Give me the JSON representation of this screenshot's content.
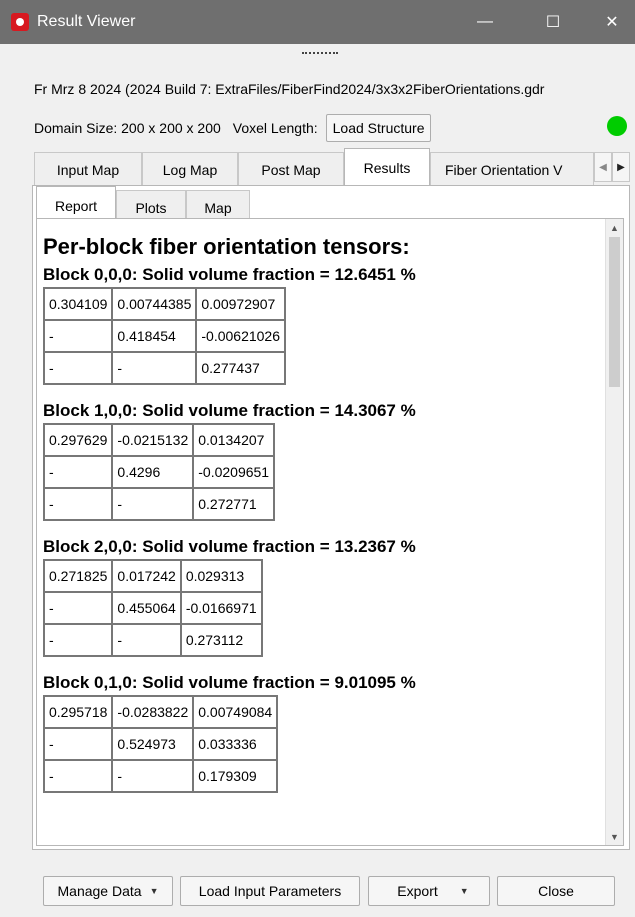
{
  "window": {
    "title": "Result Viewer",
    "minimize": "—",
    "maximize": "☐",
    "close": "✕"
  },
  "info": {
    "version_line": "Fr Mrz 8 2024 (2024 Build 7: ExtraFiles/FiberFind2024/3x3x2FiberOrientations.gdr",
    "domain_size": "Domain Size: 200 x 200 x 200",
    "voxel_length": "Voxel Length:",
    "load_structure": "Load Structure",
    "status_color": "#00cc00"
  },
  "outer_tabs": [
    "Input Map",
    "Log Map",
    "Post Map",
    "Results",
    "Fiber Orientation V"
  ],
  "inner_tabs": [
    "Report",
    "Plots",
    "Map"
  ],
  "report": {
    "heading": "Per-block fiber orientation tensors:",
    "blocks": [
      {
        "title": "Block 0,0,0: Solid volume fraction = 12.6451 %",
        "rows": [
          [
            "0.304109",
            "0.00744385",
            "0.00972907"
          ],
          [
            "-",
            "0.418454",
            "-0.00621026"
          ],
          [
            "-",
            "-",
            "0.277437"
          ]
        ]
      },
      {
        "title": "Block 1,0,0: Solid volume fraction = 14.3067 %",
        "rows": [
          [
            "0.297629",
            "-0.0215132",
            "0.0134207"
          ],
          [
            "-",
            "0.4296",
            "-0.0209651"
          ],
          [
            "-",
            "-",
            "0.272771"
          ]
        ]
      },
      {
        "title": "Block 2,0,0: Solid volume fraction = 13.2367 %",
        "rows": [
          [
            "0.271825",
            "0.017242",
            "0.029313"
          ],
          [
            "-",
            "0.455064",
            "-0.0166971"
          ],
          [
            "-",
            "-",
            "0.273112"
          ]
        ]
      },
      {
        "title": "Block 0,1,0: Solid volume fraction = 9.01095 %",
        "rows": [
          [
            "0.295718",
            "-0.0283822",
            "0.00749084"
          ],
          [
            "-",
            "0.524973",
            "0.033336"
          ],
          [
            "-",
            "-",
            "0.179309"
          ]
        ]
      }
    ]
  },
  "footer": {
    "manage_data": "Manage Data",
    "load_input_parameters": "Load Input Parameters",
    "export": "Export",
    "close": "Close"
  }
}
